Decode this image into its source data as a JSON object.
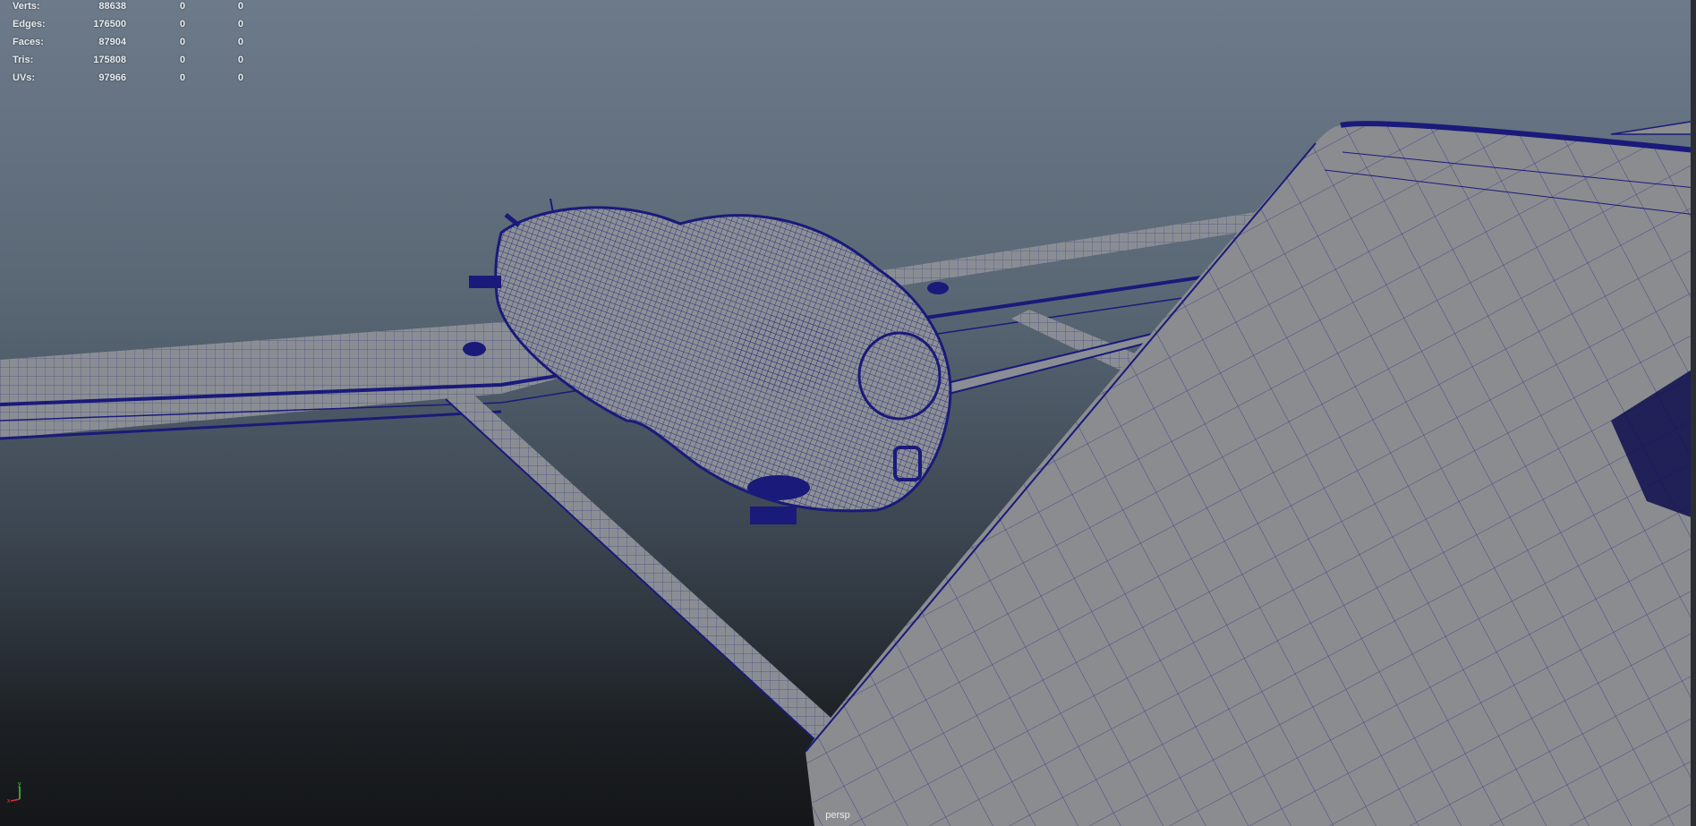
{
  "hud": {
    "rows": [
      {
        "label": "Verts:",
        "total": "88638",
        "selected": "0",
        "selected_alt": "0"
      },
      {
        "label": "Edges:",
        "total": "176500",
        "selected": "0",
        "selected_alt": "0"
      },
      {
        "label": "Faces:",
        "total": "87904",
        "selected": "0",
        "selected_alt": "0"
      },
      {
        "label": "Tris:",
        "total": "175808",
        "selected": "0",
        "selected_alt": "0"
      },
      {
        "label": "UVs:",
        "total": "97966",
        "selected": "0",
        "selected_alt": "0"
      }
    ]
  },
  "viewport": {
    "camera_label": "persp"
  },
  "axis": {
    "y_label": "y",
    "x_label": "x",
    "y_color": "#3bd13b",
    "x_color": "#e03030"
  },
  "colors": {
    "wire": "#1a1a7a",
    "surface": "#8a8c90",
    "hud_text": "#e8ecef"
  }
}
